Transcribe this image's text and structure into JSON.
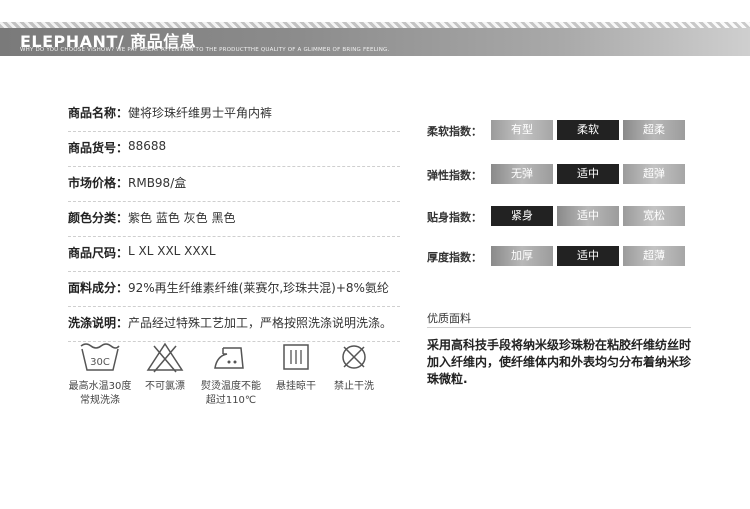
{
  "header": {
    "title": "ELEPHANT/ 商品信息",
    "subtitle": "WHY DO YOU CHOOSE VISHOW? WE PAY GREAT ATTENTION TO THE PRODUCTTHE QUALITY OF A GLIMMER OF BRING FEELING."
  },
  "info": [
    {
      "label": "商品名称：",
      "value": "健将珍珠纤维男士平角内裤"
    },
    {
      "label": "商品货号：",
      "value": "88688"
    },
    {
      "label": "市场价格：",
      "value": "RMB98/盒"
    },
    {
      "label": "颜色分类：",
      "value": "紫色 蓝色 灰色 黑色"
    },
    {
      "label": "商品尺码：",
      "value": "L XL XXL XXXL"
    },
    {
      "label": "面料成分：",
      "value": "92%再生纤维素纤维(莱赛尔,珍珠共混)+8%氨纶"
    },
    {
      "label": "洗涤说明：",
      "value": "产品经过特殊工艺加工，严格按照洗涤说明洗涤。"
    }
  ],
  "care": [
    {
      "icon": "wash-30-icon",
      "text": "30C",
      "caption1": "最高水温30度",
      "caption2": "常规洗涤"
    },
    {
      "icon": "no-bleach-icon",
      "caption1": "不可氯漂",
      "caption2": ""
    },
    {
      "icon": "iron-icon",
      "caption1": "熨烫温度不能",
      "caption2": "超过110℃"
    },
    {
      "icon": "hang-dry-icon",
      "caption1": "悬挂晾干",
      "caption2": ""
    },
    {
      "icon": "no-dry-clean-icon",
      "caption1": "禁止干洗",
      "caption2": ""
    }
  ],
  "indices": [
    {
      "label": "柔软指数：",
      "options": [
        "有型",
        "柔软",
        "超柔"
      ],
      "selected": 1
    },
    {
      "label": "弹性指数：",
      "options": [
        "无弹",
        "适中",
        "超弹"
      ],
      "selected": 1
    },
    {
      "label": "贴身指数：",
      "options": [
        "紧身",
        "适中",
        "宽松"
      ],
      "selected": 0
    },
    {
      "label": "厚度指数：",
      "options": [
        "加厚",
        "适中",
        "超薄"
      ],
      "selected": 1
    }
  ],
  "quality": {
    "title": "优质面料",
    "text": "采用高科技手段将纳米级珍珠粉在粘胶纤维纺丝时加入纤维内，使纤维体内和外表均匀分布着纳米珍珠微粒."
  }
}
